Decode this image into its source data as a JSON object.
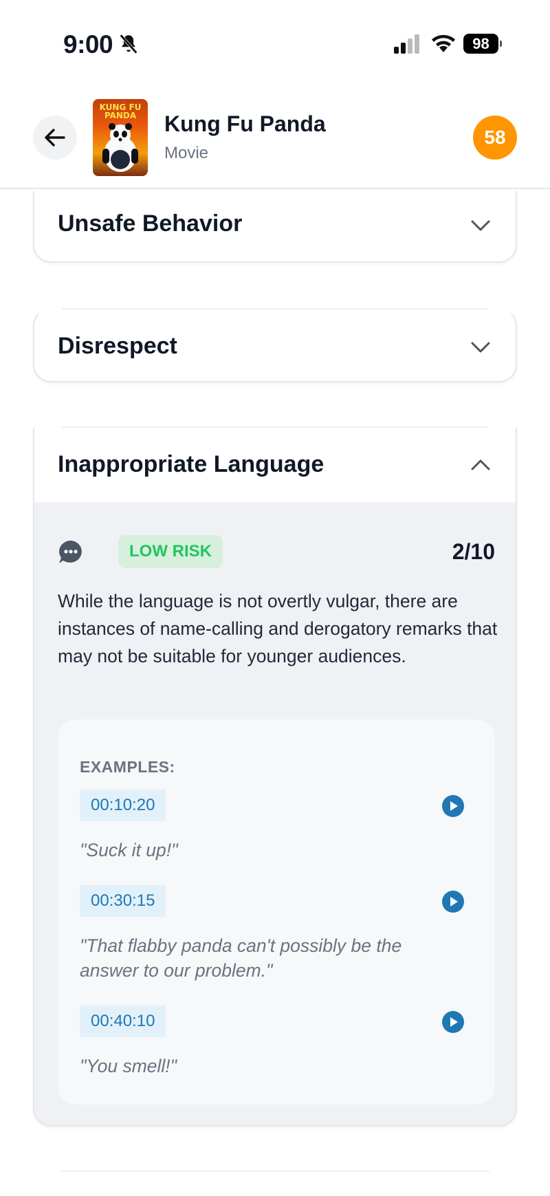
{
  "status_bar": {
    "time": "9:00",
    "battery": "98",
    "icons": [
      "bell-slash-icon",
      "cellular-signal-icon",
      "wifi-icon",
      "battery-icon"
    ]
  },
  "header": {
    "title": "Kung Fu Panda",
    "subtitle": "Movie",
    "score": "58",
    "poster_text": "KUNG FU PANDA",
    "back_icon": "arrow-left-icon"
  },
  "categories": [
    {
      "title": "Unsafe Behavior",
      "expanded": false
    },
    {
      "title": "Disrespect",
      "expanded": false
    },
    {
      "title": "Inappropriate Language",
      "expanded": true,
      "risk_label": "LOW RISK",
      "score": "2/10",
      "description": "While the language is not overtly vulgar, there are instances of name-calling and derogatory remarks that may not be suitable for younger audiences.",
      "examples_label": "EXAMPLES:",
      "examples": [
        {
          "timestamp": "00:10:20",
          "quote": "\"Suck it up!\""
        },
        {
          "timestamp": "00:30:15",
          "quote": "\"That flabby panda can't possibly be the answer to our problem.\""
        },
        {
          "timestamp": "00:40:10",
          "quote": "\"You smell!\""
        }
      ]
    }
  ],
  "colors": {
    "score_badge": "#ff9500",
    "risk_low_bg": "#d6f0dd",
    "risk_low_text": "#22c55e",
    "timestamp_bg": "#e2f0fa",
    "timestamp_text": "#1f78b4",
    "play_button": "#1f78b4"
  }
}
